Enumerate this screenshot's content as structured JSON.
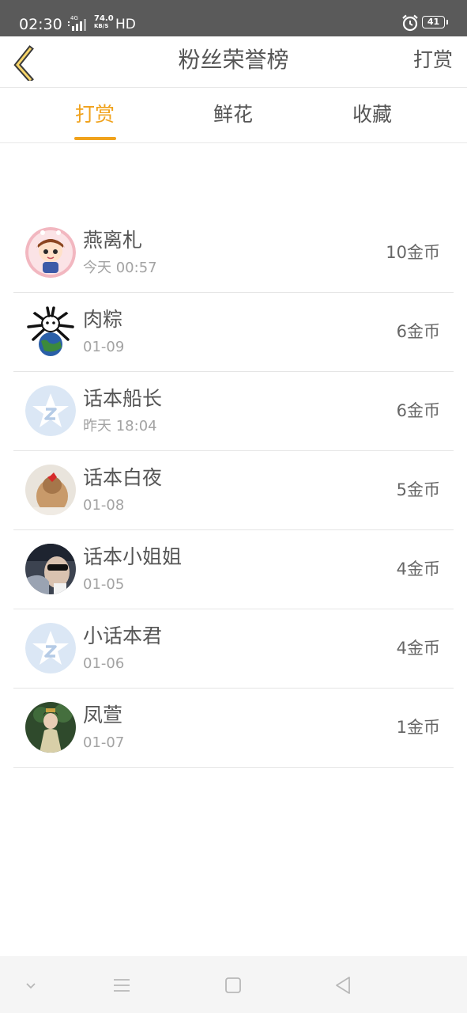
{
  "status_bar": {
    "time": "02:30",
    "net_type": "4G",
    "net_speed_value": "74.0",
    "net_speed_unit": "KB/S",
    "hd": "HD",
    "battery": "41"
  },
  "header": {
    "title": "粉丝荣誉榜",
    "action_label": "打赏",
    "back_icon": "chevron-left-icon"
  },
  "tabs": [
    {
      "label": "打赏",
      "active": true
    },
    {
      "label": "鲜花",
      "active": false
    },
    {
      "label": "收藏",
      "active": false
    }
  ],
  "fans": [
    {
      "name": "燕离札",
      "date": "今天 00:57",
      "amount": "10金币"
    },
    {
      "name": "肉粽",
      "date": "01-09",
      "amount": "6金币"
    },
    {
      "name": "话本船长",
      "date": "昨天 18:04",
      "amount": "6金币"
    },
    {
      "name": "话本白夜",
      "date": "01-08",
      "amount": "5金币"
    },
    {
      "name": "话本小姐姐",
      "date": "01-05",
      "amount": "4金币"
    },
    {
      "name": "小话本君",
      "date": "01-06",
      "amount": "4金币"
    },
    {
      "name": "凤萱",
      "date": "01-07",
      "amount": "1金币"
    }
  ],
  "colors": {
    "accent": "#f0a21c",
    "status_bar": "#5a5a5a",
    "text": "#555555",
    "subtext": "#a3a3a3"
  }
}
